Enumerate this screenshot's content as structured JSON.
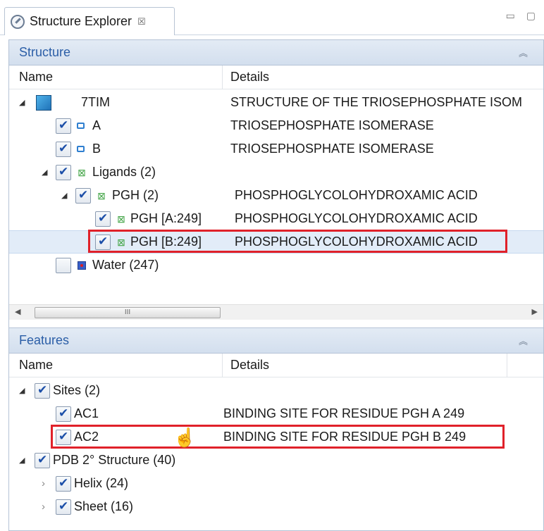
{
  "tab": {
    "title": "Structure Explorer",
    "close": "☒",
    "controls": "▭ ▢"
  },
  "structure": {
    "header": "Structure",
    "columns": {
      "name": "Name",
      "details": "Details"
    },
    "rows": [
      {
        "label": "7TIM",
        "details": "STRUCTURE OF THE TRIOSEPHOSPHATE ISOM"
      },
      {
        "label": "A",
        "details": "TRIOSEPHOSPHATE ISOMERASE"
      },
      {
        "label": "B",
        "details": "TRIOSEPHOSPHATE ISOMERASE"
      },
      {
        "label": "Ligands (2)",
        "details": ""
      },
      {
        "label": "PGH (2)",
        "details": "PHOSPHOGLYCOLOHYDROXAMIC ACID"
      },
      {
        "label": "PGH [A:249]",
        "details": "PHOSPHOGLYCOLOHYDROXAMIC ACID"
      },
      {
        "label": "PGH [B:249]",
        "details": "PHOSPHOGLYCOLOHYDROXAMIC ACID"
      },
      {
        "label": "Water (247)",
        "details": ""
      }
    ],
    "scroll_grip": "III"
  },
  "features": {
    "header": "Features",
    "columns": {
      "name": "Name",
      "details": "Details"
    },
    "rows": [
      {
        "label": "Sites (2)",
        "details": ""
      },
      {
        "label": "AC1",
        "details": "BINDING SITE FOR RESIDUE PGH A 249"
      },
      {
        "label": "AC2",
        "details": "BINDING SITE FOR RESIDUE PGH B 249"
      },
      {
        "label": "PDB 2° Structure (40)",
        "details": ""
      },
      {
        "label": "Helix (24)",
        "details": ""
      },
      {
        "label": "Sheet (16)",
        "details": ""
      }
    ]
  },
  "colors": {
    "accent": "#2b5ea7",
    "highlight": "#e0212a",
    "selection": "#e2ecf8"
  }
}
